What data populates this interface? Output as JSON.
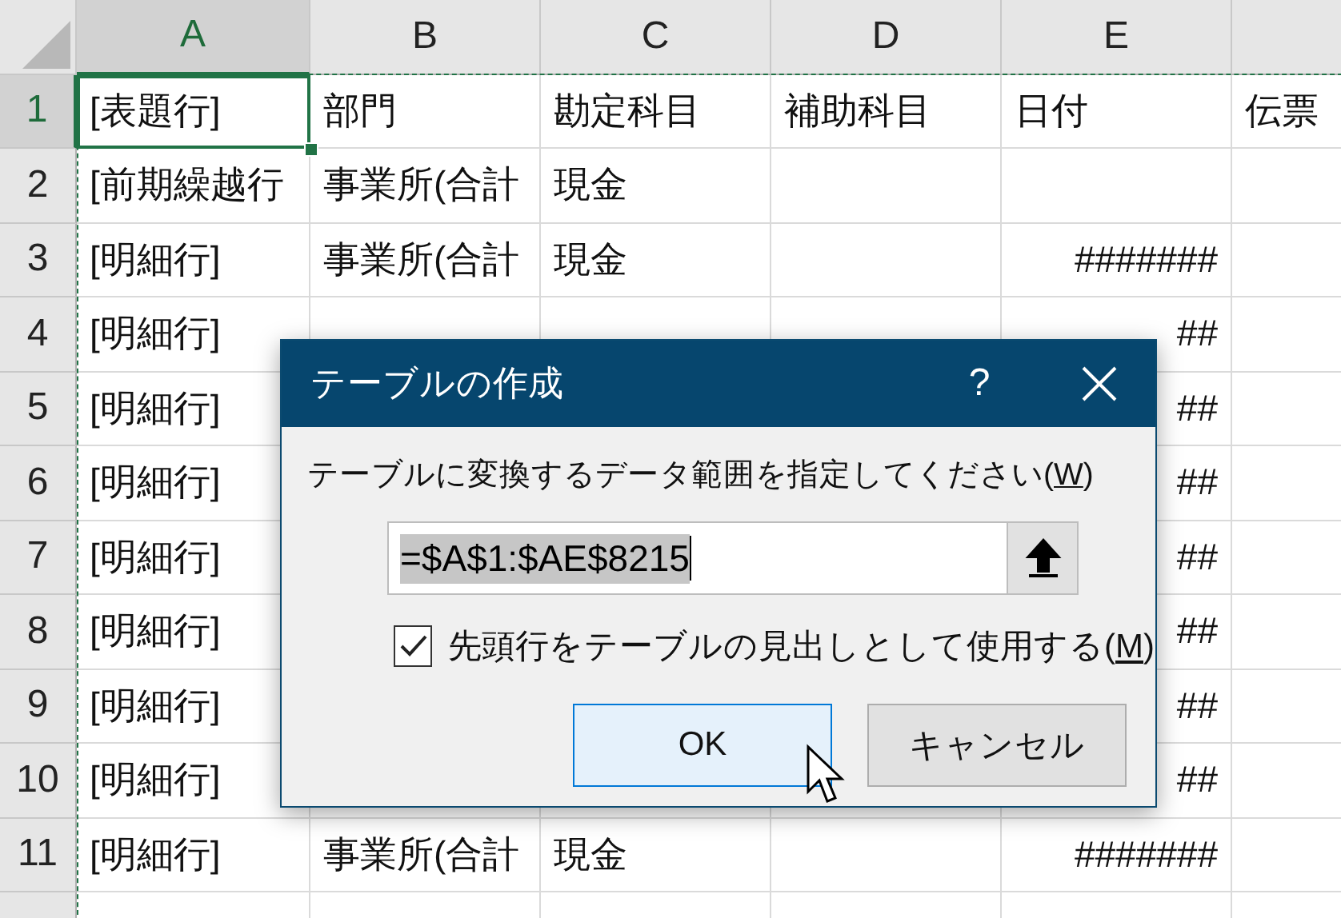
{
  "columns": [
    {
      "label": "A",
      "selected": true
    },
    {
      "label": "B",
      "selected": false
    },
    {
      "label": "C",
      "selected": false
    },
    {
      "label": "D",
      "selected": false
    },
    {
      "label": "E",
      "selected": false
    }
  ],
  "rows": [
    {
      "label": "1",
      "selected": true,
      "kind": "header",
      "cells": {
        "A": "[表題行]",
        "B": "部門",
        "C": "勘定科目",
        "D": "補助科目",
        "E": "日付",
        "F": "伝票"
      }
    },
    {
      "label": "2",
      "selected": false,
      "cells": {
        "A": "[前期繰越行",
        "B": "事業所(合計",
        "C": "現金"
      }
    },
    {
      "label": "3",
      "selected": false,
      "cells": {
        "A": "[明細行]",
        "B": "事業所(合計",
        "C": "現金",
        "E": "#######"
      }
    },
    {
      "label": "4",
      "selected": false,
      "cells": {
        "A": "[明細行]",
        "E": "##"
      }
    },
    {
      "label": "5",
      "selected": false,
      "cells": {
        "A": "[明細行]",
        "E": "##"
      }
    },
    {
      "label": "6",
      "selected": false,
      "cells": {
        "A": "[明細行]",
        "E": "##"
      }
    },
    {
      "label": "7",
      "selected": false,
      "cells": {
        "A": "[明細行]",
        "E": "##"
      }
    },
    {
      "label": "8",
      "selected": false,
      "cells": {
        "A": "[明細行]",
        "E": "##"
      }
    },
    {
      "label": "9",
      "selected": false,
      "cells": {
        "A": "[明細行]",
        "E": "##"
      }
    },
    {
      "label": "10",
      "selected": false,
      "cells": {
        "A": "[明細行]",
        "E": "##"
      }
    },
    {
      "label": "11",
      "selected": false,
      "cells": {
        "A": "[明細行]",
        "B": "事業所(合計",
        "C": "現金",
        "E": "#######"
      }
    }
  ],
  "dialog": {
    "title": "テーブルの作成",
    "help": "?",
    "prompt": {
      "before": "テーブルに変換するデータ範囲を指定してください(",
      "key": "W",
      "after": ")"
    },
    "range": {
      "value": "=$A$1:$AE$8215",
      "selected": true
    },
    "header_checkbox": {
      "before": "先頭行をテーブルの見出しとして使用する(",
      "key": "M",
      "after": ")",
      "checked": true
    },
    "buttons": [
      {
        "label": "OK",
        "kind": "default"
      },
      {
        "label": "キャンセル",
        "kind": "normal"
      }
    ]
  }
}
